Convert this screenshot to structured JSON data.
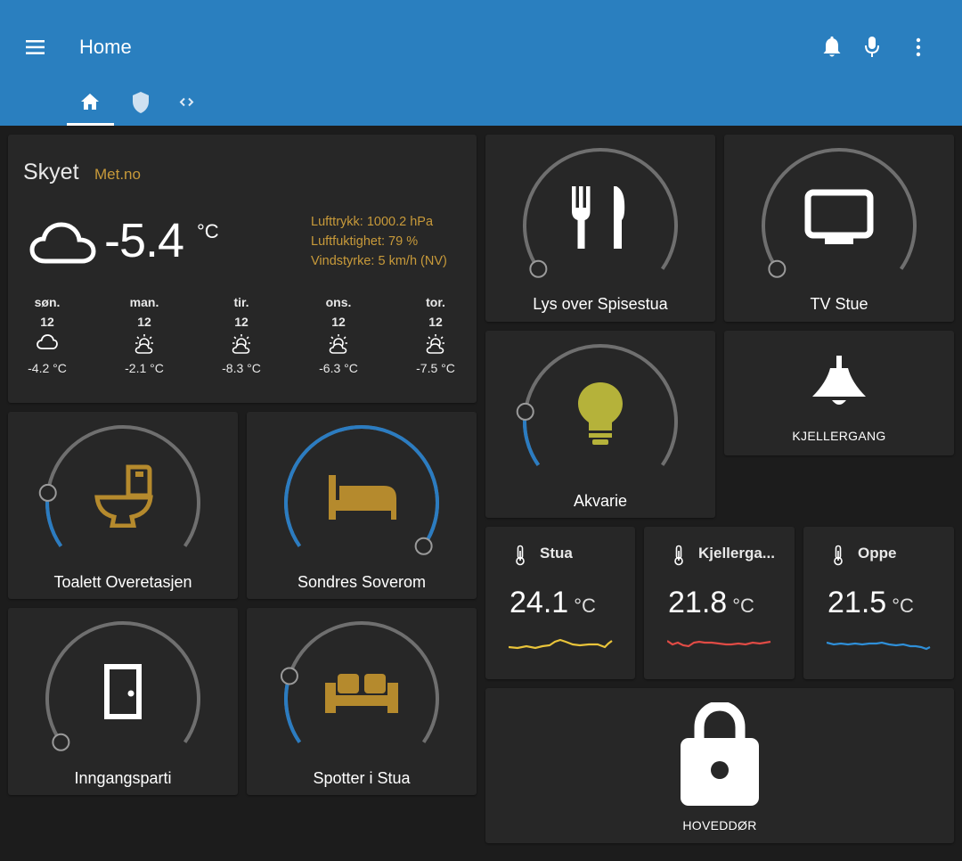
{
  "header": {
    "title": "Home",
    "tabs": [
      "home-icon",
      "shield-icon",
      "code-icon"
    ]
  },
  "weather": {
    "condition": "Skyet",
    "source": "Met.no",
    "temperature": "-5.4",
    "unit": "°C",
    "attributes": [
      "Lufttrykk: 1000.2 hPa",
      "Luftfuktighet: 79 %",
      "Vindstyrke: 5 km/h (NV)"
    ],
    "forecast": [
      {
        "day": "søn.",
        "date": "12",
        "temp": "-4.2 °C",
        "icon": "cloudy-icon"
      },
      {
        "day": "man.",
        "date": "12",
        "temp": "-2.1 °C",
        "icon": "night-partly-cloudy-icon"
      },
      {
        "day": "tir.",
        "date": "12",
        "temp": "-8.3 °C",
        "icon": "night-partly-cloudy-icon"
      },
      {
        "day": "ons.",
        "date": "12",
        "temp": "-6.3 °C",
        "icon": "night-partly-cloudy-icon"
      },
      {
        "day": "tor.",
        "date": "12",
        "temp": "-7.5 °C",
        "icon": "night-partly-cloudy-icon"
      }
    ]
  },
  "lights": {
    "spisestua": {
      "name": "Lys over Spisestua",
      "icon": "silverware-icon",
      "level": 0
    },
    "tv": {
      "name": "TV Stue",
      "icon": "television-icon",
      "level": 0
    },
    "akvarie": {
      "name": "Akvarie",
      "icon": "lightbulb-icon",
      "level": 0.17
    },
    "toalett": {
      "name": "Toalett Overetasjen",
      "icon": "toilet-icon",
      "level": 0.17
    },
    "soverom": {
      "name": "Sondres Soverom",
      "icon": "bed-icon",
      "level": 1
    },
    "inngang": {
      "name": "Inngangsparti",
      "icon": "door-icon",
      "level": 0
    },
    "spotter": {
      "name": "Spotter i Stua",
      "icon": "sofa-icon",
      "level": 0.21
    }
  },
  "kjellergang_button": {
    "name": "KJELLERGANG",
    "icon": "ceiling-lamp-icon"
  },
  "sensors": [
    {
      "name": "Stua",
      "value": "24.1",
      "unit": "°C",
      "color": "#e9c43a"
    },
    {
      "name": "Kjellerga...",
      "value": "21.8",
      "unit": "°C",
      "color": "#e04b45"
    },
    {
      "name": "Oppe",
      "value": "21.5",
      "unit": "°C",
      "color": "#2f8fd8"
    }
  ],
  "lock": {
    "name": "HOVEDDØR",
    "icon": "lock-icon"
  },
  "colors": {
    "header": "#2a7fbf",
    "accent": "#2b7cc1",
    "source": "#c89a3a",
    "active_icon": "#b58a2d"
  }
}
